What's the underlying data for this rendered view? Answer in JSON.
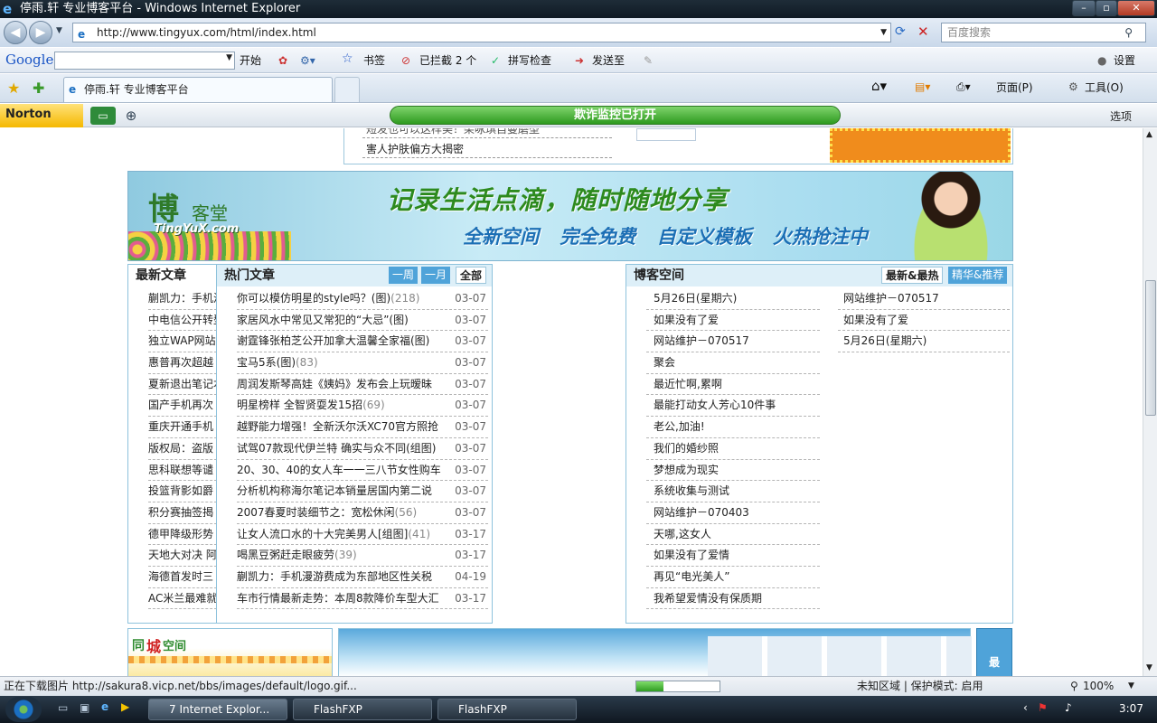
{
  "window": {
    "title": "停雨.轩 专业博客平台 - Windows Internet Explorer"
  },
  "address": {
    "url": "http://www.tingyux.com/html/index.html",
    "search_placeholder": "百度搜索"
  },
  "google_toolbar": {
    "brand": "Google",
    "start_label": "开始",
    "bookmarks_label": "书签",
    "blocked_label": "已拦截 2 个",
    "spellcheck_label": "拼写检查",
    "sendto_label": "发送至",
    "settings_label": "设置"
  },
  "tab": {
    "title": "停雨.轩 专业博客平台",
    "page_label": "页面(P)",
    "tools_label": "工具(O)"
  },
  "norton": {
    "brand": "Norton",
    "fraud_text": "欺诈监控已打开",
    "options_label": "选项"
  },
  "top_box": {
    "items": [
      "短发也可以这样美！柴咏琪自曼磨型",
      "害人护肤偏方大揭密"
    ]
  },
  "banner": {
    "logo_big": "博",
    "logo_small": "客堂",
    "site": "TingYuX.com",
    "slogan_main": "记录生活点滴，随时随地分享",
    "slogan_sub": "全新空间 完全免费 自定义模板 火热抢注中"
  },
  "latest": {
    "title": "最新文章",
    "items": [
      "蒯凯力：手机漫游费成为东部地区性关税",
      "中电信公开转型",
      "独立WAP网站",
      "惠普再次超越",
      "夏新退出笔记本",
      "国产手机再次",
      "重庆开通手机",
      "版权局：盗版",
      "思科联想等谴",
      "投篮背影如爵",
      "积分赛抽签揭",
      "德甲降级形势",
      "天地大对决 阿",
      "海德首发时三",
      "AC米兰最难就"
    ]
  },
  "hot": {
    "title": "热门文章",
    "tabs": [
      "一周",
      "一月",
      "全部"
    ],
    "rows": [
      {
        "title": "你可以模仿明星的style吗？(图)",
        "count": "(218)",
        "date": "03-07"
      },
      {
        "title": "家居风水中常见又常犯的“大忌”(图)",
        "count": "",
        "date": "03-07"
      },
      {
        "title": "谢霆锋张柏芝公开加拿大温馨全家福(图)",
        "count": "",
        "date": "03-07"
      },
      {
        "title": "宝马5系(图)",
        "count": "(83)",
        "date": "03-07"
      },
      {
        "title": "周润发斯琴高娃《姨妈》发布会上玩暧昧",
        "count": "",
        "date": "03-07"
      },
      {
        "title": "明星榜样 全智贤耍发15招",
        "count": "(69)",
        "date": "03-07"
      },
      {
        "title": "越野能力增强！全新沃尔沃XC70官方照抢",
        "count": "",
        "date": "03-07"
      },
      {
        "title": "试驾07款现代伊兰特 确实与众不同(组图)",
        "count": "",
        "date": "03-07"
      },
      {
        "title": "20、30、40的女人车一一三八节女性购车",
        "count": "",
        "date": "03-07"
      },
      {
        "title": "分析机构称海尔笔记本销量居国内第二说",
        "count": "",
        "date": "03-07"
      },
      {
        "title": "2007春夏时装细节之：宽松休闲",
        "count": "(56)",
        "date": "03-07"
      },
      {
        "title": "让女人流口水的十大完美男人[组图]",
        "count": "(41)",
        "date": "03-17"
      },
      {
        "title": "喝黑豆粥赶走眼疲劳",
        "count": "(39)",
        "date": "03-17"
      },
      {
        "title": "蒯凯力：手机漫游费成为东部地区性关税",
        "count": "",
        "date": "04-19"
      },
      {
        "title": "车市行情最新走势：本周8款降价车型大汇",
        "count": "",
        "date": "03-17"
      }
    ]
  },
  "blog": {
    "title": "博客空间",
    "tabs": [
      "最新&最热",
      "精华&推荐"
    ],
    "left": [
      "5月26日(星期六)",
      "如果没有了爱",
      "网站维护－070517",
      "聚会",
      "最近忙啊,累啊",
      "最能打动女人芳心10件事",
      "老公,加油!",
      "我们的婚纱照",
      "梦想成为现实",
      "系统收集与测试",
      "网站维护－070403",
      "天哪,这女人",
      "如果没有了爱情",
      "再见“电光美人”",
      "我希望爱情没有保质期"
    ],
    "right": [
      "网站维护－070517",
      "如果没有了爱",
      "5月26日(星期六)"
    ]
  },
  "bottom": {
    "city_label_a": "同",
    "city_label_b": "城",
    "city_label_c": "空间",
    "right_badge": "最"
  },
  "status": {
    "text": "正在下载图片 http://sakura8.vicp.net/bbs/images/default/logo.gif...",
    "progress": 0.33,
    "zone": "未知区域 | 保护模式: 启用",
    "zoom": "100%"
  },
  "taskbar": {
    "tasks": [
      "7 Internet Explor...",
      "FlashFXP",
      "FlashFXP"
    ],
    "clock": "3:07"
  },
  "colors": {
    "accent_blue": "#4fa3d9",
    "green": "#2e9a1f",
    "orange": "#f08c1c"
  }
}
